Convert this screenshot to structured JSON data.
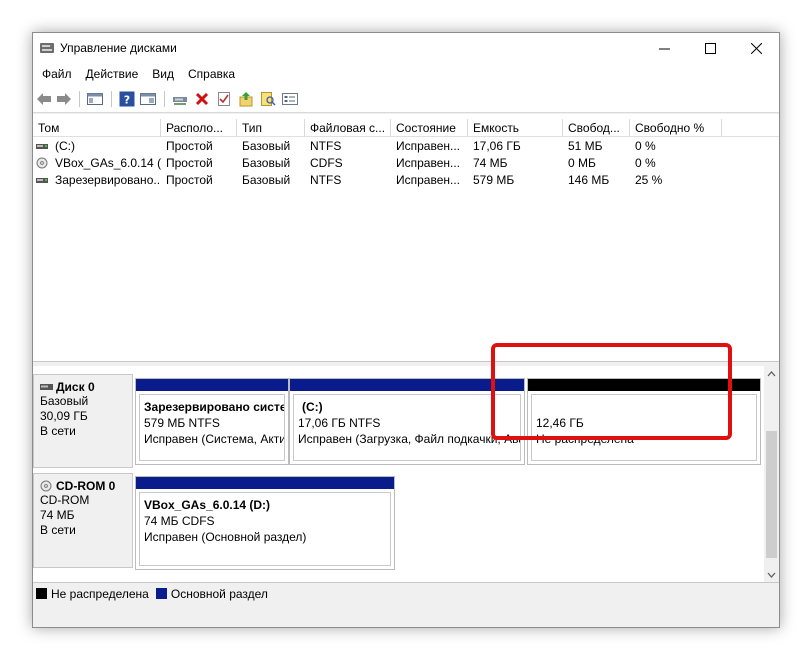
{
  "window": {
    "title": "Управление дисками",
    "icon": "disk-management-icon"
  },
  "menu": [
    {
      "label": "Файл"
    },
    {
      "label": "Действие"
    },
    {
      "label": "Вид"
    },
    {
      "label": "Справка"
    }
  ],
  "toolbar": {
    "buttons": [
      "back-arrow-icon",
      "forward-arrow-icon",
      "console-tree-icon",
      "help-icon",
      "properties-icon",
      "connect-icon",
      "delete-icon",
      "check-icon",
      "export-icon",
      "find-icon",
      "settings-icon"
    ]
  },
  "volumes": {
    "columns": [
      "Том",
      "Располо...",
      "Тип",
      "Файловая с...",
      "Состояние",
      "Емкость",
      "Свобод...",
      "Свободно %"
    ],
    "rows": [
      {
        "name": "(C:)",
        "layout": "Простой",
        "type": "Базовый",
        "fs": "NTFS",
        "status": "Исправен...",
        "capacity": "17,06 ГБ",
        "free": "51 МБ",
        "free_pct": "0 %",
        "icon": "drive-icon"
      },
      {
        "name": "VBox_GAs_6.0.14 (...",
        "layout": "Простой",
        "type": "Базовый",
        "fs": "CDFS",
        "status": "Исправен...",
        "capacity": "74 МБ",
        "free": "0 МБ",
        "free_pct": "0 %",
        "icon": "cd-icon"
      },
      {
        "name": "Зарезервировано...",
        "layout": "Простой",
        "type": "Базовый",
        "fs": "NTFS",
        "status": "Исправен...",
        "capacity": "579 МБ",
        "free": "146 МБ",
        "free_pct": "25 %",
        "icon": "drive-icon"
      }
    ]
  },
  "disks": [
    {
      "name": "Диск 0",
      "type": "Базовый",
      "size": "30,09 ГБ",
      "state": "В сети",
      "partitions": [
        {
          "title": "Зарезервировано систе",
          "detail": "579 МБ NTFS",
          "status": "Исправен (Система, Акти"
        },
        {
          "title": "(C:)",
          "detail": "17,06 ГБ NTFS",
          "status": "Исправен (Загрузка, Файл подкачки, Ава"
        },
        {
          "title": "",
          "detail": "12,46 ГБ",
          "status": "Не распределена"
        }
      ]
    },
    {
      "name": "CD-ROM 0",
      "type": "CD-ROM",
      "size": "74 МБ",
      "state": "В сети",
      "partitions": [
        {
          "title": "VBox_GAs_6.0.14  (D:)",
          "detail": "74 МБ CDFS",
          "status": "Исправен (Основной раздел)"
        }
      ]
    }
  ],
  "legend": [
    {
      "label": "Не распределена",
      "color": "#000000"
    },
    {
      "label": "Основной раздел",
      "color": "#0a1c8c"
    }
  ],
  "colors": {
    "primary_bar": "#0a1c8c",
    "unallocated_bar": "#000000",
    "highlight": "#e01010"
  }
}
